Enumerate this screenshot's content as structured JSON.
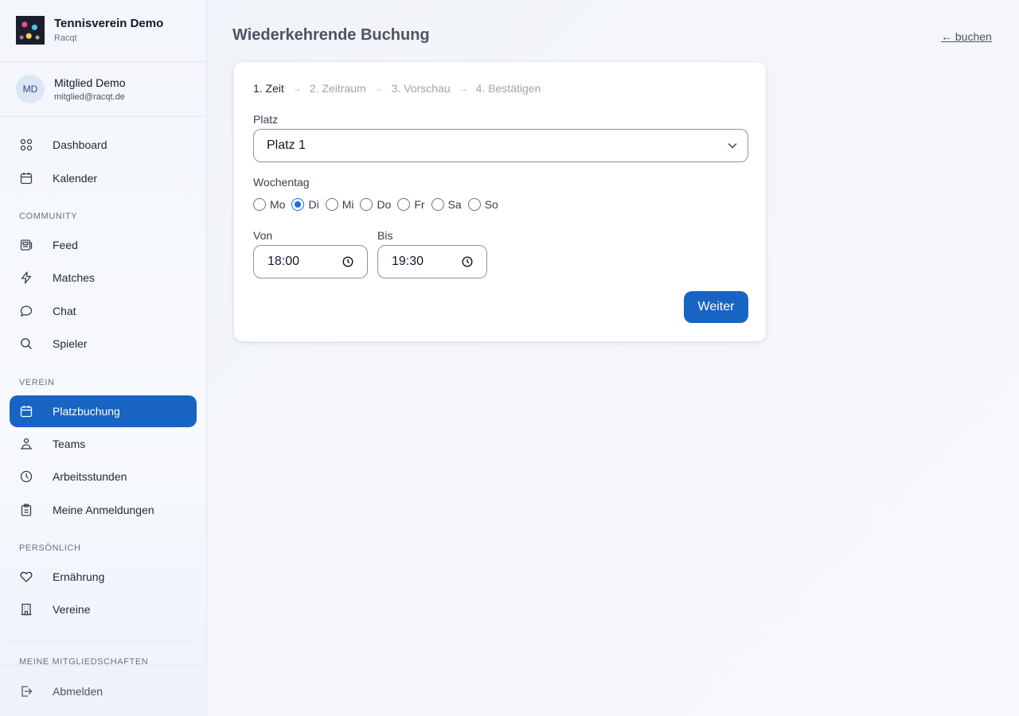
{
  "club": {
    "name": "Tennisverein Demo",
    "subtitle": "Racqt"
  },
  "user": {
    "initials": "MD",
    "name": "Mitglied Demo",
    "email": "mitglied@racqt.de"
  },
  "nav": {
    "dashboard": "Dashboard",
    "calendar": "Kalender",
    "community_label": "COMMUNITY",
    "feed": "Feed",
    "matches": "Matches",
    "chat": "Chat",
    "players": "Spieler",
    "club_label": "VEREIN",
    "court_booking": "Platzbuchung",
    "teams": "Teams",
    "work_hours": "Arbeitsstunden",
    "registrations": "Meine Anmeldungen",
    "personal_label": "PERSÖNLICH",
    "nutrition": "Ernährung",
    "clubs": "Vereine",
    "memberships_label": "MEINE MITGLIEDSCHAFTEN",
    "logout": "Abmelden"
  },
  "page": {
    "title": "Wiederkehrende Buchung",
    "back_link": "← buchen"
  },
  "wizard": {
    "steps": [
      "1. Zeit",
      "2. Zeitraum",
      "3. Vorschau",
      "4. Bestätigen"
    ],
    "court_label": "Platz",
    "court_value": "Platz 1",
    "weekday_label": "Wochentag",
    "weekdays": [
      "Mo",
      "Di",
      "Mi",
      "Do",
      "Fr",
      "Sa",
      "So"
    ],
    "selected_weekday": "Di",
    "from_label": "Von",
    "from_value": "18:00",
    "to_label": "Bis",
    "to_value": "19:30",
    "next_button": "Weiter"
  },
  "colors": {
    "accent": "#1864c2",
    "radio_checked": "#1a6cdb"
  }
}
